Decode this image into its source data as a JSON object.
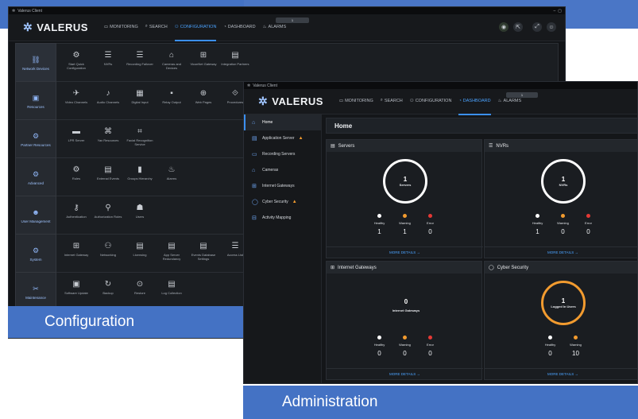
{
  "colors": {
    "accent": "#3b8ff0",
    "brand_blue": "#4472c4",
    "healthy": "#ffffff",
    "warning": "#f29b2f",
    "error": "#e53935"
  },
  "config_window": {
    "titlebar": "Valerus Client",
    "logo": "VALERUS",
    "tab_counter": "1",
    "nav": [
      {
        "label": "MONITORING",
        "icon": "monitor-icon"
      },
      {
        "label": "SEARCH",
        "icon": "search-icon"
      },
      {
        "label": "CONFIGURATION",
        "icon": "network-icon",
        "active": true
      },
      {
        "label": "DASHBOARD",
        "icon": "dashboard-icon"
      },
      {
        "label": "ALARMS",
        "icon": "alarm-icon"
      }
    ],
    "rows": [
      {
        "category": "Network Devices",
        "icon": "network-devices-icon",
        "tiles": [
          {
            "label": "Start Quick Configuration",
            "icon": "wizard-icon"
          },
          {
            "label": "NVRs",
            "icon": "nvr-icon"
          },
          {
            "label": "Recording Failover",
            "icon": "failover-icon"
          },
          {
            "label": "Cameras and Devices",
            "icon": "camera-icon"
          },
          {
            "label": "ViconNet Gateway",
            "icon": "gateway-icon"
          },
          {
            "label": "Integration Partners",
            "icon": "integration-icon"
          }
        ]
      },
      {
        "category": "Resources",
        "icon": "resources-icon",
        "tiles": [
          {
            "label": "Video Channels",
            "icon": "video-icon"
          },
          {
            "label": "Audio Channels",
            "icon": "mic-icon"
          },
          {
            "label": "Digital Input",
            "icon": "input-icon"
          },
          {
            "label": "Relay Output",
            "icon": "relay-icon"
          },
          {
            "label": "Web Pages",
            "icon": "globe-icon"
          },
          {
            "label": "Procedures",
            "icon": "procedure-icon"
          }
        ]
      },
      {
        "category": "Partner Resources",
        "icon": "partner-icon",
        "tiles": [
          {
            "label": "LPR Server",
            "icon": "lpr-icon"
          },
          {
            "label": "Yax Resources",
            "icon": "yax-icon"
          },
          {
            "label": "Facial Recognition Service",
            "icon": "face-icon"
          }
        ]
      },
      {
        "category": "Advanced",
        "icon": "advanced-icon",
        "tiles": [
          {
            "label": "Rules",
            "icon": "rules-icon"
          },
          {
            "label": "External Events",
            "icon": "events-icon"
          },
          {
            "label": "Groups Hierarchy",
            "icon": "folder-icon"
          },
          {
            "label": "Alarms",
            "icon": "alarm-icon"
          }
        ]
      },
      {
        "category": "User Management",
        "icon": "users-icon",
        "tiles": [
          {
            "label": "Authentication",
            "icon": "key-icon"
          },
          {
            "label": "Authorization Roles",
            "icon": "roles-icon"
          },
          {
            "label": "Users",
            "icon": "user-icon"
          }
        ]
      },
      {
        "category": "System",
        "icon": "gear-icon",
        "tiles": [
          {
            "label": "Internet Gateway",
            "icon": "gateway-icon"
          },
          {
            "label": "Networking",
            "icon": "network-icon"
          },
          {
            "label": "Licensing",
            "icon": "license-icon"
          },
          {
            "label": "App Server Redundancy",
            "icon": "server-icon"
          },
          {
            "label": "Events Database Settings",
            "icon": "database-icon"
          },
          {
            "label": "Access List",
            "icon": "list-icon"
          }
        ]
      },
      {
        "category": "Maintenance",
        "icon": "tools-icon",
        "tiles": [
          {
            "label": "Software Update",
            "icon": "update-icon"
          },
          {
            "label": "Backup",
            "icon": "backup-icon"
          },
          {
            "label": "Restore",
            "icon": "restore-icon"
          },
          {
            "label": "Log Collection",
            "icon": "log-icon"
          }
        ]
      }
    ],
    "caption": "Configuration"
  },
  "admin_window": {
    "titlebar": "Valerus Client",
    "logo": "VALERUS",
    "tab_counter": "1",
    "nav": [
      {
        "label": "MONITORING",
        "icon": "monitor-icon"
      },
      {
        "label": "SEARCH",
        "icon": "search-icon"
      },
      {
        "label": "CONFIGURATION",
        "icon": "network-icon"
      },
      {
        "label": "DASHBOARD",
        "icon": "dashboard-icon",
        "active": true
      },
      {
        "label": "ALARMS",
        "icon": "alarm-icon"
      }
    ],
    "sidebar": [
      {
        "label": "Home",
        "icon": "home-icon",
        "active": true
      },
      {
        "label": "Application Server",
        "icon": "server-icon",
        "warning": true
      },
      {
        "label": "Recording Servers",
        "icon": "recording-icon"
      },
      {
        "label": "Cameras",
        "icon": "camera-icon"
      },
      {
        "label": "Internet Gateways",
        "icon": "gateway-icon"
      },
      {
        "label": "Cyber Security",
        "icon": "shield-icon",
        "warning": true
      },
      {
        "label": "Activity Mapping",
        "icon": "activity-icon"
      }
    ],
    "page_title": "Home",
    "cards": [
      {
        "title": "Servers",
        "icon": "server-icon",
        "count": "1",
        "count_label": "Servers",
        "ring": "white",
        "stats": [
          {
            "label": "Healthy",
            "value": "1",
            "color": "#ffffff"
          },
          {
            "label": "Warning",
            "value": "1",
            "color": "#f29b2f"
          },
          {
            "label": "Error",
            "value": "0",
            "color": "#e53935"
          }
        ],
        "more": "MORE DETAILS →"
      },
      {
        "title": "NVRs",
        "icon": "nvr-icon",
        "count": "1",
        "count_label": "NVRs",
        "ring": "white",
        "stats": [
          {
            "label": "Healthy",
            "value": "1",
            "color": "#ffffff"
          },
          {
            "label": "Warning",
            "value": "0",
            "color": "#f29b2f"
          },
          {
            "label": "Error",
            "value": "0",
            "color": "#e53935"
          }
        ],
        "more": "MORE DETAILS →"
      },
      {
        "title": "Internet Gateways",
        "icon": "gateway-icon",
        "count": "0",
        "count_label": "Internet Gateways",
        "ring": "none",
        "stats": [
          {
            "label": "Healthy",
            "value": "0",
            "color": "#ffffff"
          },
          {
            "label": "Warning",
            "value": "0",
            "color": "#f29b2f"
          },
          {
            "label": "Error",
            "value": "0",
            "color": "#e53935"
          }
        ],
        "more": "MORE DETAILS →"
      },
      {
        "title": "Cyber Security",
        "icon": "shield-icon",
        "count": "1",
        "count_label": "Logged In Users",
        "ring": "orange",
        "stats": [
          {
            "label": "Healthy",
            "value": "0",
            "color": "#ffffff"
          },
          {
            "label": "Warning",
            "value": "10",
            "color": "#f29b2f"
          }
        ],
        "more": "MORE DETAILS →"
      }
    ],
    "caption": "Administration"
  }
}
